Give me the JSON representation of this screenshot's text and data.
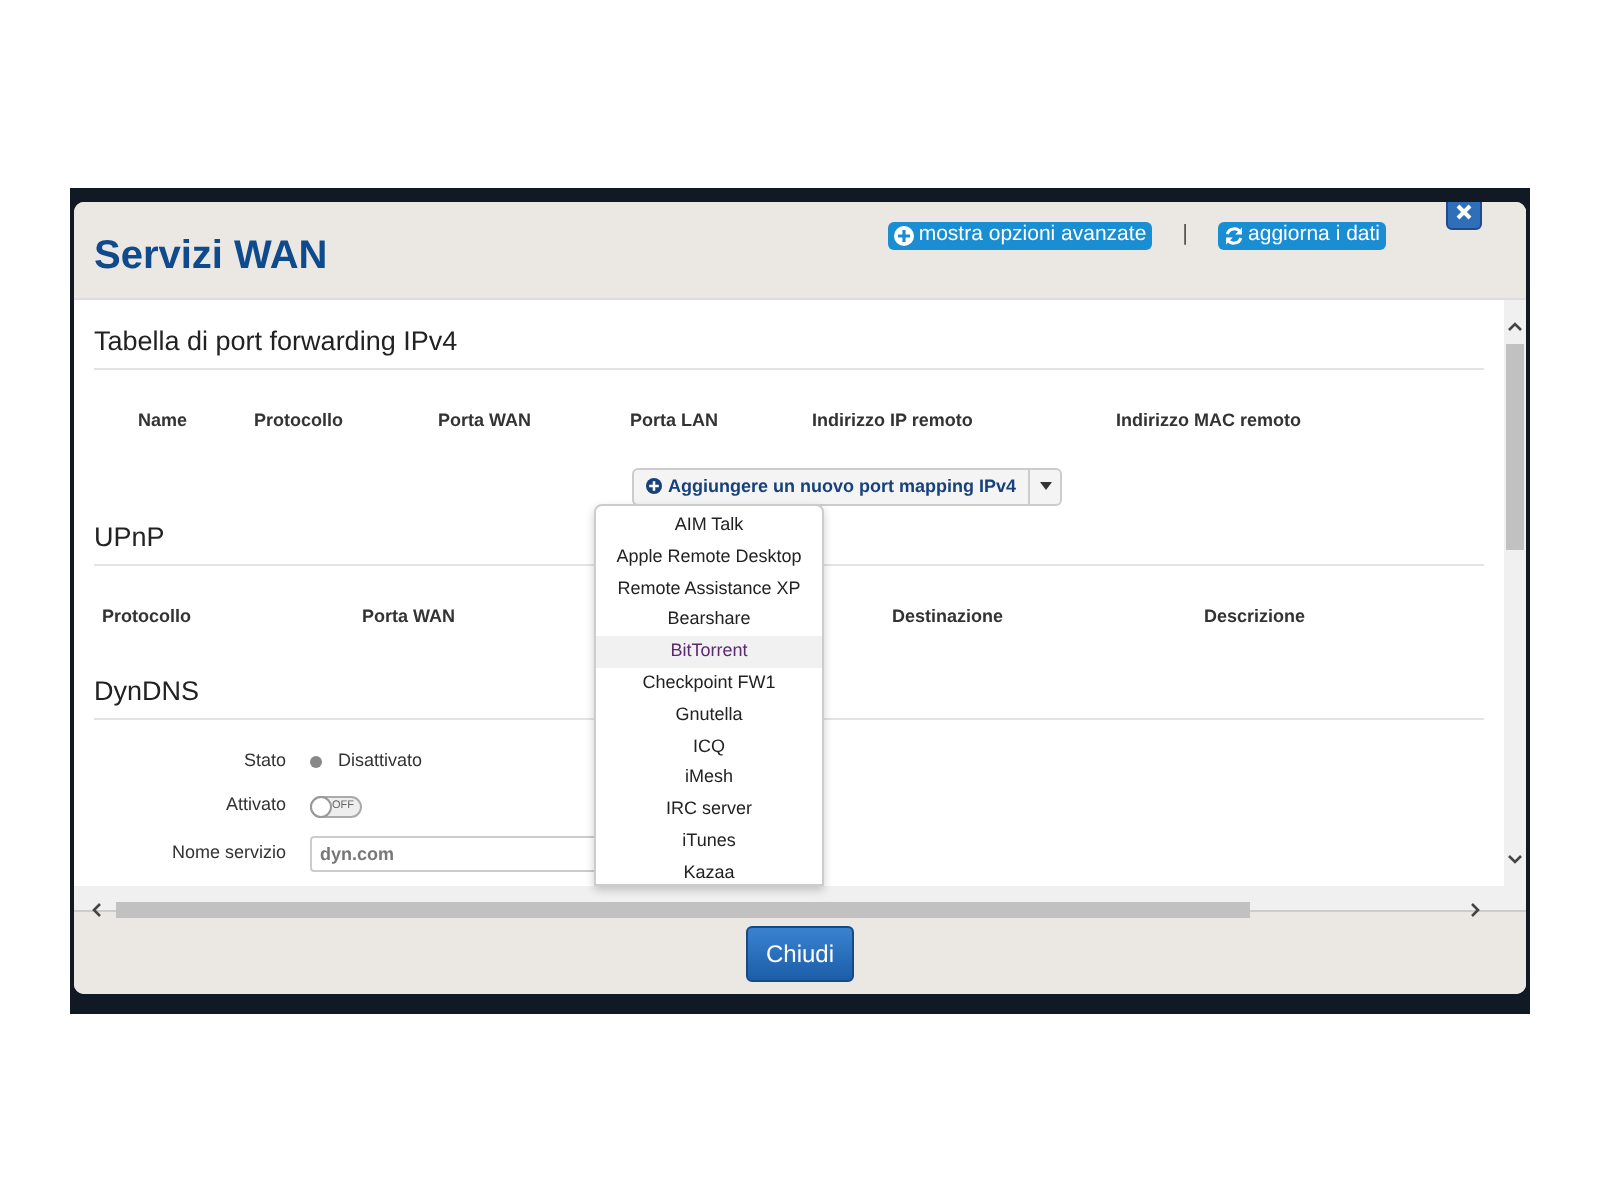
{
  "dialog": {
    "title": "Servizi WAN",
    "header_links": [
      {
        "kind": "plus",
        "label": "mostra opzioni avanzate"
      },
      {
        "kind": "refresh",
        "label": "aggiorna i dati"
      }
    ],
    "separator": "|"
  },
  "port_forwarding": {
    "title": "Tabella di port forwarding IPv4",
    "columns": [
      "Name",
      "Protocollo",
      "Porta WAN",
      "Porta LAN",
      "Indirizzo IP remoto",
      "Indirizzo MAC remoto"
    ],
    "add_button": {
      "label": "Aggiungere un nuovo port mapping IPv4"
    },
    "dropdown": [
      {
        "label": "AIM Talk",
        "selected": false
      },
      {
        "label": "Apple Remote Desktop",
        "selected": false
      },
      {
        "label": "Remote Assistance XP",
        "selected": false
      },
      {
        "label": "Bearshare",
        "selected": false
      },
      {
        "label": "BitTorrent",
        "selected": true
      },
      {
        "label": "Checkpoint FW1",
        "selected": false
      },
      {
        "label": "Gnutella",
        "selected": false
      },
      {
        "label": "ICQ",
        "selected": false
      },
      {
        "label": "iMesh",
        "selected": false
      },
      {
        "label": "IRC server",
        "selected": false
      },
      {
        "label": "iTunes",
        "selected": false
      },
      {
        "label": "Kazaa",
        "selected": false
      }
    ]
  },
  "upnp": {
    "title": "UPnP",
    "columns": [
      "Protocollo",
      "Porta WAN",
      "Destinazione",
      "Descrizione"
    ]
  },
  "dyndns": {
    "title": "DynDNS",
    "fields": [
      {
        "kind": "status",
        "label": "Stato",
        "value": "Disattivato"
      },
      {
        "kind": "toggle",
        "label": "Attivato",
        "on": false,
        "text": "OFF"
      },
      {
        "kind": "input",
        "label": "Nome servizio",
        "value": "dyn.com"
      }
    ]
  },
  "footer": {
    "button": "Chiudi"
  }
}
